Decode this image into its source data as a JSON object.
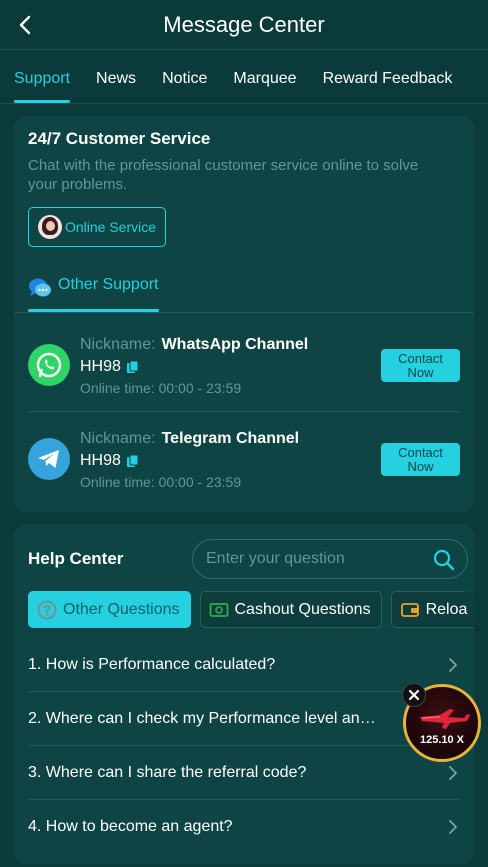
{
  "header": {
    "title": "Message Center"
  },
  "tabs": [
    {
      "label": "Support",
      "active": true
    },
    {
      "label": "News",
      "active": false
    },
    {
      "label": "Notice",
      "active": false
    },
    {
      "label": "Marquee",
      "active": false
    },
    {
      "label": "Reward Feedback",
      "active": false
    }
  ],
  "service": {
    "title": "24/7 Customer Service",
    "description": "Chat with the professional customer service online to solve your problems.",
    "online_button": "Online Service",
    "other_support_label": "Other Support",
    "channels": [
      {
        "nickname_label": "Nickname:",
        "nickname": "WhatsApp Channel",
        "id": "HH98",
        "time_label": "Online time:",
        "time": "00:00 - 23:59",
        "contact_label": "Contact Now",
        "icon": "whatsapp-icon"
      },
      {
        "nickname_label": "Nickname:",
        "nickname": "Telegram Channel",
        "id": "HH98",
        "time_label": "Online time:",
        "time": "00:00 - 23:59",
        "contact_label": "Contact Now",
        "icon": "telegram-icon"
      }
    ]
  },
  "help": {
    "title": "Help Center",
    "search_placeholder": "Enter your question",
    "chips": [
      {
        "label": "Other Questions",
        "active": true,
        "icon": "question-circle-icon"
      },
      {
        "label": "Cashout Questions",
        "active": false,
        "icon": "cash-icon"
      },
      {
        "label": "Reloa",
        "active": false,
        "icon": "wallet-icon"
      }
    ],
    "faqs": [
      "1. How is Performance calculated?",
      "2. Where can I check my Performance level an…",
      "3. Where can I share the referral code?",
      "4. How to become an agent?"
    ]
  },
  "float_widget": {
    "value": "125.10 X"
  },
  "colors": {
    "accent": "#25d0e0",
    "background": "#0b3a3a",
    "card": "#0f4444",
    "whatsapp": "#2fd466",
    "telegram": "#37a3dc"
  }
}
